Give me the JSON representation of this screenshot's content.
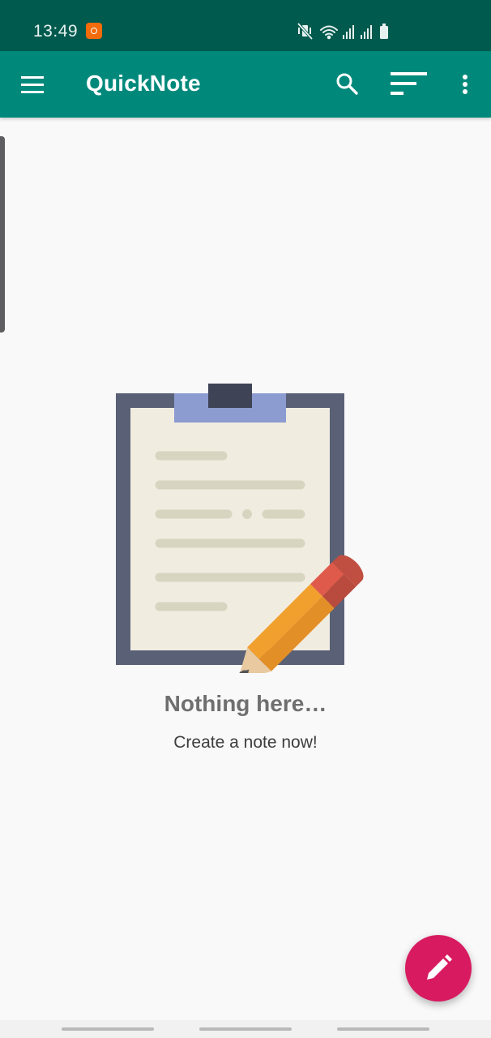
{
  "status_bar": {
    "time": "13:49",
    "icons": [
      "app-notification-icon",
      "vibrate-mute-icon",
      "wifi-icon",
      "signal-icon",
      "signal-icon",
      "battery-icon"
    ]
  },
  "app_bar": {
    "title": "QuickNote",
    "background_color": "#00897b",
    "actions": [
      "menu-icon",
      "search-icon",
      "sort-icon",
      "more-vert-icon"
    ]
  },
  "empty_state": {
    "title": "Nothing here…",
    "subtitle": "Create a note now!",
    "illustration": "clipboard-pencil-illustration"
  },
  "fab": {
    "icon": "pencil-icon",
    "color": "#d81b60"
  },
  "colors": {
    "status_bar": "#005a4e",
    "accent": "#d81b60",
    "background": "#f9f9f9"
  }
}
